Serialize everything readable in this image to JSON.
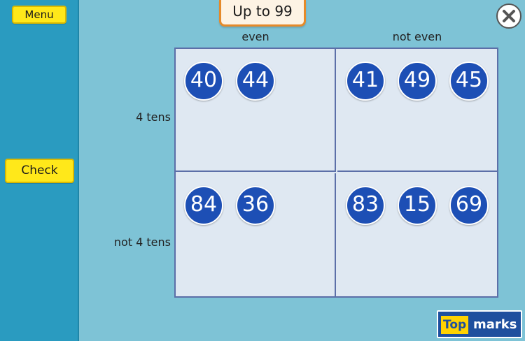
{
  "sidebar": {
    "menu_label": "Menu",
    "check_label": "Check"
  },
  "title": "Up to 99",
  "columns": {
    "even": "even",
    "not_even": "not even"
  },
  "rows": {
    "four_tens": "4 tens",
    "not_four_tens": "not 4 tens"
  },
  "cells": {
    "four_tens_even": [
      "40",
      "44"
    ],
    "four_tens_not_even": [
      "41",
      "49",
      "45"
    ],
    "not_four_tens_even": [
      "84",
      "36"
    ],
    "not_four_tens_not_even": [
      "83",
      "15",
      "69"
    ]
  },
  "logo": {
    "top": "Top",
    "marks": "marks"
  },
  "colors": {
    "ball": "#1d4fb5",
    "sidebar": "#2a9bc0",
    "background": "#7ec3d6",
    "button": "#ffe81a",
    "tab_border": "#e58a2a"
  },
  "icons": {
    "close": "close-icon"
  }
}
